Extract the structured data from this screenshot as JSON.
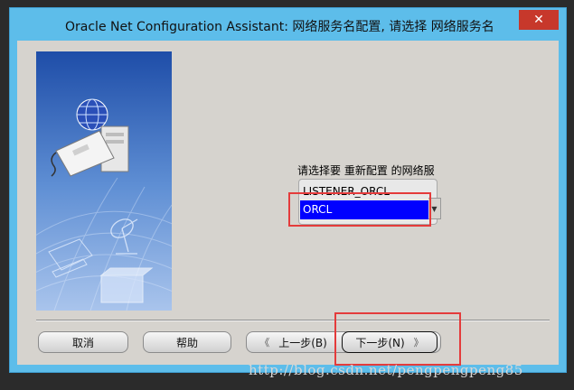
{
  "window": {
    "title": "Oracle Net Configuration Assistant: 网络服务名配置, 请选择 网络服务名",
    "close_glyph": "✕"
  },
  "content": {
    "prompt": "请选择要 重新配置 的网络服",
    "list_items": [
      "LISTENER_ORCL",
      "ORCL"
    ],
    "selected_item": "ORCL"
  },
  "buttons": {
    "cancel": "取消",
    "help": "帮助",
    "back": "上一步(B)",
    "back_glyph": "《",
    "next": "下一步(N)",
    "next_glyph": "》"
  },
  "watermark": "http://blog.csdn.net/pengpengpeng85",
  "colors": {
    "titlebar": "#5dbdea",
    "close": "#c7382b",
    "selection": "#0000ff",
    "annotation": "#e43b3b"
  }
}
